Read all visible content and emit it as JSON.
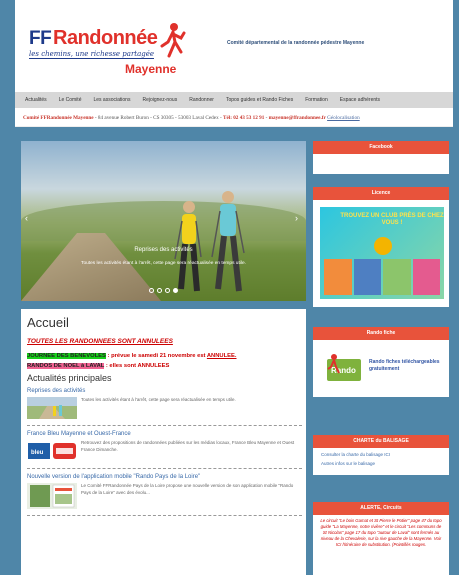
{
  "header": {
    "logo_ff": "FF",
    "logo_rando": "Randonnée",
    "logo_tagline": "les chemins, une richesse partagée",
    "logo_region": "Mayenne",
    "committee": "Comité départemental de la randonnée pédestre Mayenne"
  },
  "nav": {
    "items": [
      {
        "label": "Actualités"
      },
      {
        "label": "Le Comité"
      },
      {
        "label": "Les associations"
      },
      {
        "label": "Rejoignez-nous"
      },
      {
        "label": "Randonner"
      },
      {
        "label": "Topos guides et Rando Fiches"
      },
      {
        "label": "Formation"
      },
      {
        "label": "Espace adhérents"
      }
    ]
  },
  "contact": {
    "name": "Comité FFRandonnée Mayenne",
    "address": " - 84 avenue Robert Buron - CS 30305 - 53003 Laval Cedex - ",
    "tel": "Tél: 02 43 53 12 91",
    "sep": " - ",
    "email": "mayenne@ffrandonnee.fr",
    "geo": "Géolocalisation"
  },
  "slider": {
    "title": "Reprises des activités",
    "text": "Toutes les activités étant à l'arrêt, cette page sera réactualisée en temps utile.",
    "prev_icon": "‹",
    "next_icon": "›",
    "dots": 4,
    "active_dot": 3
  },
  "content": {
    "title": "Accueil",
    "alert": "TOUTES LES RANDONNEES SONT ANNULEES",
    "benevoles_label": "JOURNEE DES BENEVOLES",
    "benevoles_text": " : prévue le samedi 21 novembre  est ",
    "benevoles_status": "ANNULEE.",
    "noel_label": "RANDOS DE NOEL à LAVAL",
    "noel_text": " : elles sont ANNULEES",
    "news_heading": "Actualités principales",
    "news": [
      {
        "title": "Reprises des activités",
        "text": "Toutes les activités étant à l'arrêt, cette page sera réactualisée en temps utile."
      },
      {
        "title": "France Bleu Mayenne et Ouest-France",
        "text": "Retrouvez des propositions de randonnées publiées sur les médias locaux, France Bleu Mayenne et Ouest France Dimanche."
      },
      {
        "title": "Nouvelle version de l'application mobile \"Rando Pays de la Loire\"",
        "text": "Le Comité FFRandonnée Pays de la Loire propose une nouvelle version de son application mobile \"Rando Pays de la Loire\" avec des évolu..."
      }
    ]
  },
  "sidebar": {
    "facebook": "Facebook",
    "licence": "Licence",
    "licence_img_text": "TROUVEZ UN CLUB PRÈS DE CHEZ VOUS !",
    "randofiche": "Rando fiche",
    "randofiche_text": "Rando fiches téléchargeables gratuitement",
    "charte": "CHARTE du BALISAGE",
    "charte_link1": "Consulter la charte du balisage ICI",
    "charte_link2": "Autres infos sur le balisage",
    "alerte": "ALERTE, Circuits",
    "alerte_text": "Le circuit \"Le bois Gamat et St Pierre le Potier\" page 47 du topo guide \"La Mayenne, notre rivière\" et le circuit \"Les communs de St Nicolas\" page 17 du topo \"autour de Laval\" sont fermés au niveau de la Chevalerie, sur la rive gauche de la Mayenne. Voir ICI l'itinéraire de substitution. (Pointillés rouges."
  }
}
